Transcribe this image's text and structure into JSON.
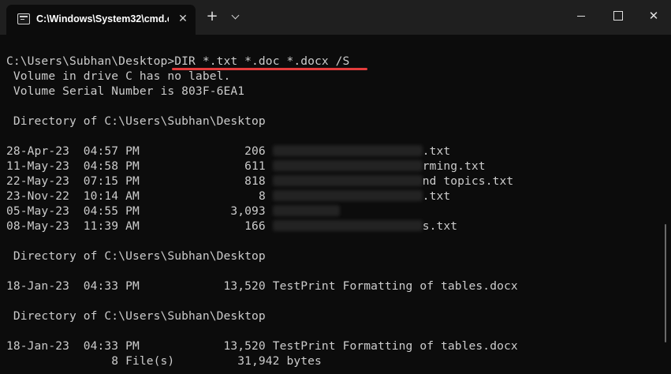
{
  "window": {
    "tab_title": "C:\\Windows\\System32\\cmd.e",
    "tab_close": "✕",
    "new_tab": "+",
    "close": "✕"
  },
  "console": {
    "prompt": "C:\\Users\\Subhan\\Desktop>",
    "command": "DIR *.txt *.doc *.docx /S",
    "volume_label": " Volume in drive C has no label.",
    "volume_serial": " Volume Serial Number is 803F-6EA1",
    "directory_header": " Directory of C:\\Users\\Subhan\\Desktop",
    "txt_entries": [
      {
        "date": "28-Apr-23",
        "time": "04:57 PM",
        "size": "206",
        "name_visible": ".txt"
      },
      {
        "date": "11-May-23",
        "time": "04:58 PM",
        "size": "611",
        "name_visible": "rming.txt"
      },
      {
        "date": "22-May-23",
        "time": "07:15 PM",
        "size": "818",
        "name_visible": "nd topics.txt"
      },
      {
        "date": "23-Nov-22",
        "time": "10:14 AM",
        "size": "8",
        "name_visible": ".txt"
      },
      {
        "date": "05-May-23",
        "time": "04:55 PM",
        "size": "3,093",
        "name_visible": ""
      },
      {
        "date": "08-May-23",
        "time": "11:39 AM",
        "size": "166",
        "name_visible": "s.txt"
      }
    ],
    "doc_entry": {
      "date": "18-Jan-23",
      "time": "04:33 PM",
      "size": "13,520",
      "name": "TestPrint Formatting of tables.docx"
    },
    "docx_entry": {
      "date": "18-Jan-23",
      "time": "04:33 PM",
      "size": "13,520",
      "name": "TestPrint Formatting of tables.docx"
    },
    "summary": "               8 File(s)         31,942 bytes"
  }
}
